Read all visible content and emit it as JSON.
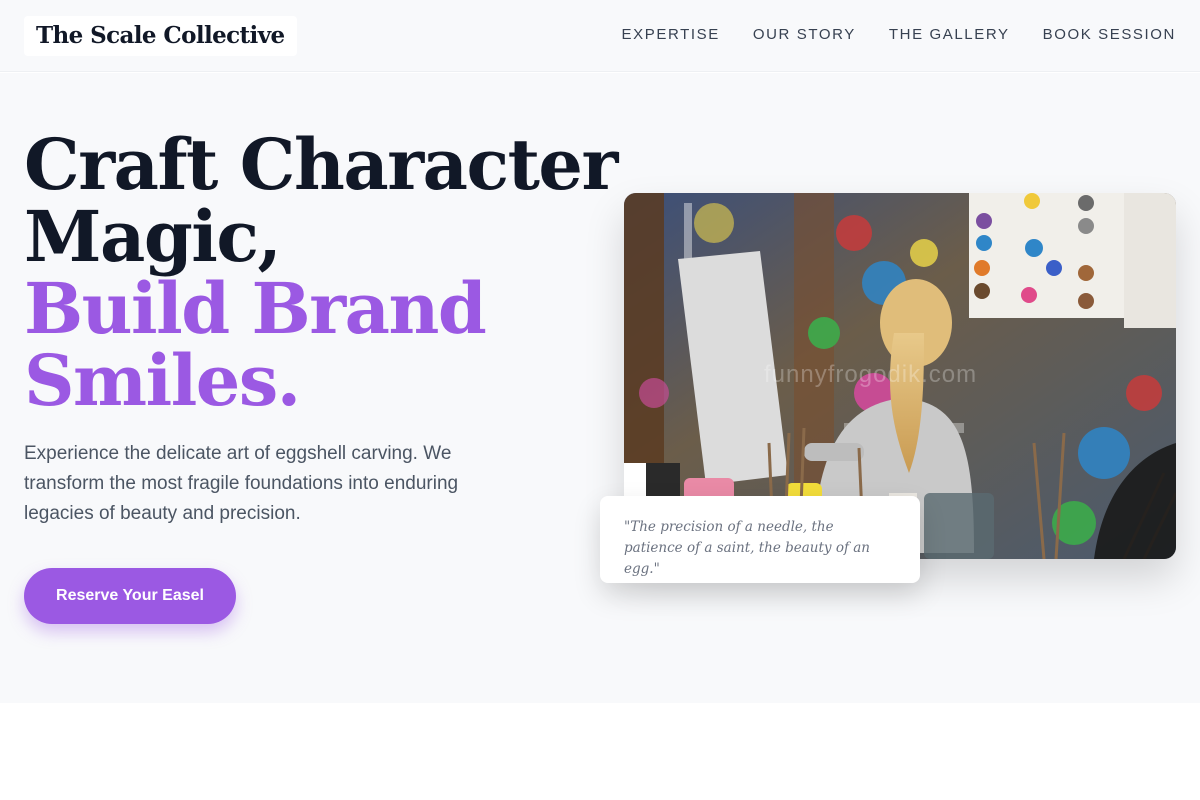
{
  "header": {
    "logo": "The Scale Collective",
    "nav": [
      "EXPERTISE",
      "OUR STORY",
      "THE GALLERY",
      "BOOK SESSION"
    ]
  },
  "hero": {
    "headline_line1": "Craft Character",
    "headline_line2": "Magic,",
    "headline_line3": "Build Brand",
    "headline_line4": "Smiles.",
    "description": "Experience the delicate art of eggshell carving. We transform the most fragile foundations into enduring legacies of beauty and precision.",
    "cta_label": "Reserve Your Easel",
    "image_alt": "Child painting in an art studio",
    "watermark": "funnyfrogodik.com",
    "quote": "\"The precision of a needle, the patience of a saint, the beauty of an egg.\""
  },
  "colors": {
    "accent": "#9b59e3",
    "heading": "#111827",
    "hero_background": "#f8f9fb"
  }
}
